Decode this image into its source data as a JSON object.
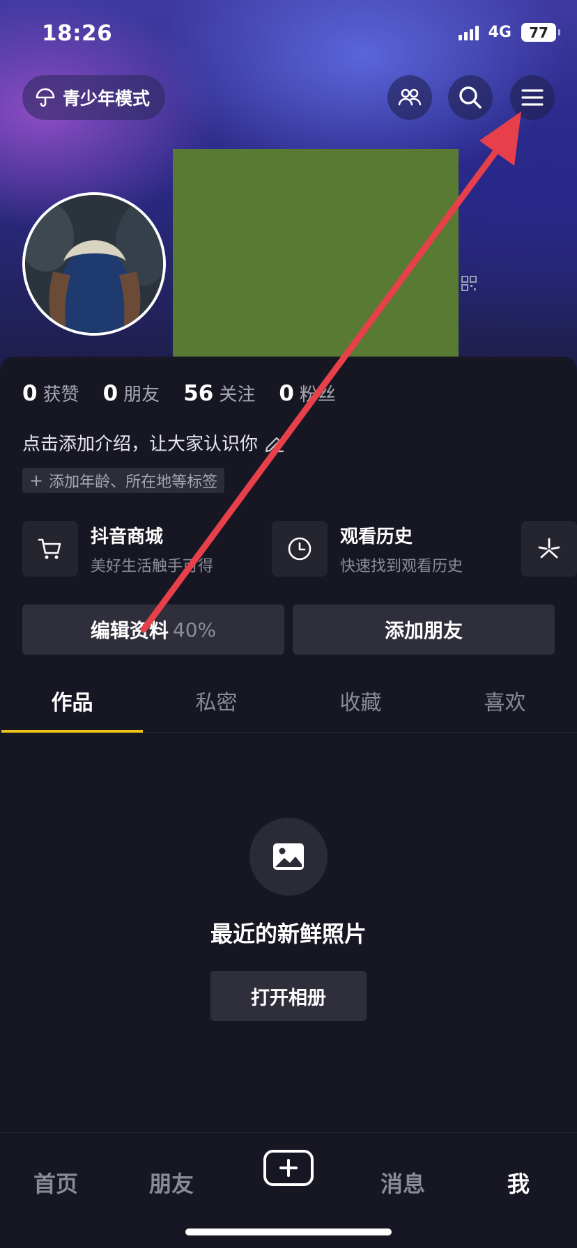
{
  "status_bar": {
    "time": "18:26",
    "network": "4G",
    "battery": "77"
  },
  "header": {
    "teen_mode_label": "青少年模式",
    "icons": [
      "friends-icon",
      "search-icon",
      "menu-icon"
    ]
  },
  "profile": {
    "stats": [
      {
        "value": "0",
        "label": "获赞"
      },
      {
        "value": "0",
        "label": "朋友"
      },
      {
        "value": "56",
        "label": "关注"
      },
      {
        "value": "0",
        "label": "粉丝"
      }
    ],
    "bio_placeholder": "点击添加介绍，让大家认识你",
    "tag_chip": "添加年龄、所在地等标签"
  },
  "services": [
    {
      "title": "抖音商城",
      "subtitle": "美好生活触手可得",
      "icon": "cart-icon"
    },
    {
      "title": "观看历史",
      "subtitle": "快速找到观看历史",
      "icon": "clock-icon"
    }
  ],
  "actions": {
    "edit_profile": "编辑资料",
    "edit_profile_percent": "40%",
    "add_friend": "添加朋友"
  },
  "tabs": [
    {
      "label": "作品",
      "active": true
    },
    {
      "label": "私密",
      "active": false
    },
    {
      "label": "收藏",
      "active": false
    },
    {
      "label": "喜欢",
      "active": false
    }
  ],
  "empty_state": {
    "title": "最近的新鲜照片",
    "button": "打开相册"
  },
  "bottom_nav": {
    "home": "首页",
    "friends": "朋友",
    "messages": "消息",
    "me": "我",
    "active": "我"
  },
  "colors": {
    "accent_tab_underline": "#f2c318",
    "annotation_arrow": "#e8404a",
    "redaction": "#587a33"
  }
}
